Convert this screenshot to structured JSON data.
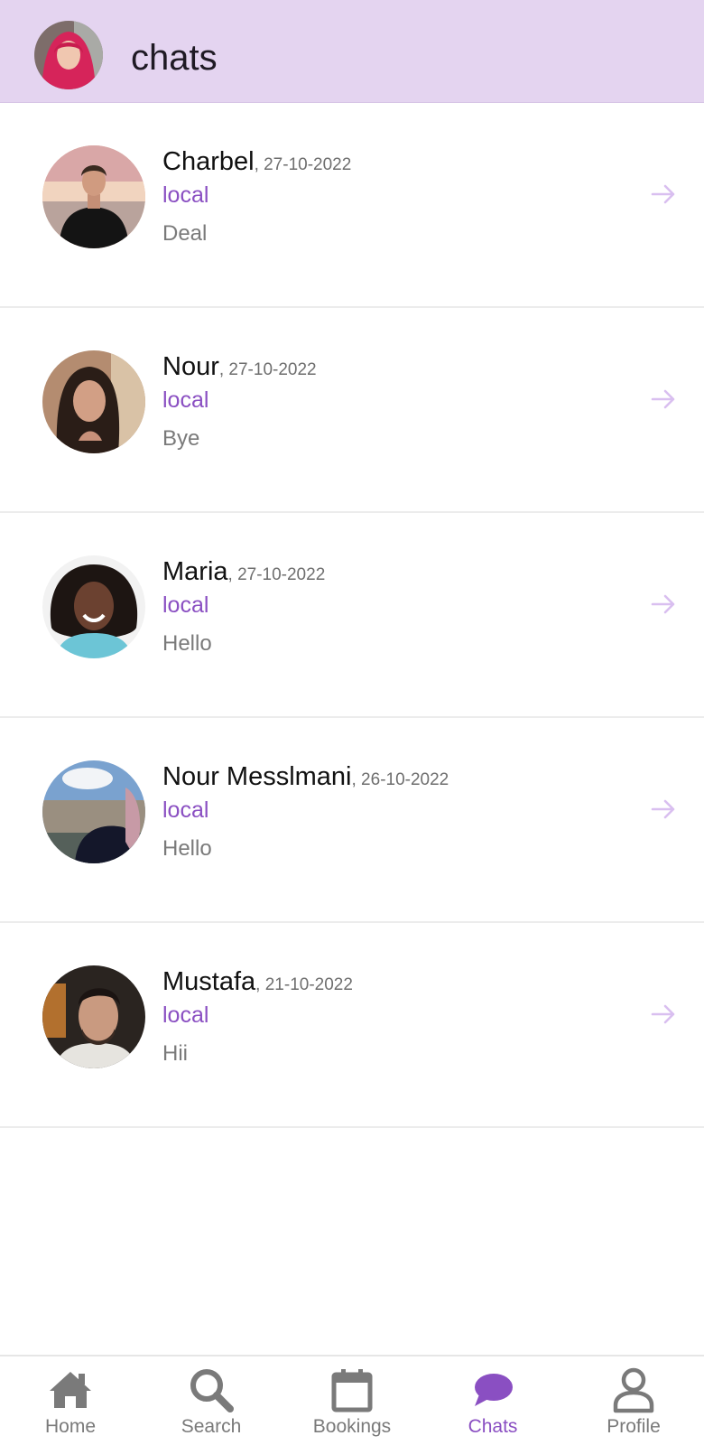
{
  "header": {
    "title": "chats"
  },
  "chats": [
    {
      "name": "Charbel",
      "date": ", 27-10-2022",
      "type": "local",
      "message": "Deal"
    },
    {
      "name": "Nour",
      "date": ", 27-10-2022",
      "type": "local",
      "message": "Bye"
    },
    {
      "name": "Maria",
      "date": ", 27-10-2022",
      "type": "local",
      "message": "Hello"
    },
    {
      "name": "Nour Messlmani",
      "date": ", 26-10-2022",
      "type": "local",
      "message": "Hello"
    },
    {
      "name": "Mustafa",
      "date": ", 21-10-2022",
      "type": "local",
      "message": "Hii"
    }
  ],
  "nav": {
    "items": [
      {
        "label": "Home",
        "icon": "home-icon"
      },
      {
        "label": "Search",
        "icon": "search-icon"
      },
      {
        "label": "Bookings",
        "icon": "calendar-icon"
      },
      {
        "label": "Chats",
        "icon": "chat-bubble-icon"
      },
      {
        "label": "Profile",
        "icon": "person-icon"
      }
    ],
    "active": "Chats"
  },
  "colors": {
    "header_bg": "#e4d4f0",
    "accent": "#8a4fc2",
    "arrow": "#d9bff0",
    "nav_inactive": "#7a7a7a"
  }
}
